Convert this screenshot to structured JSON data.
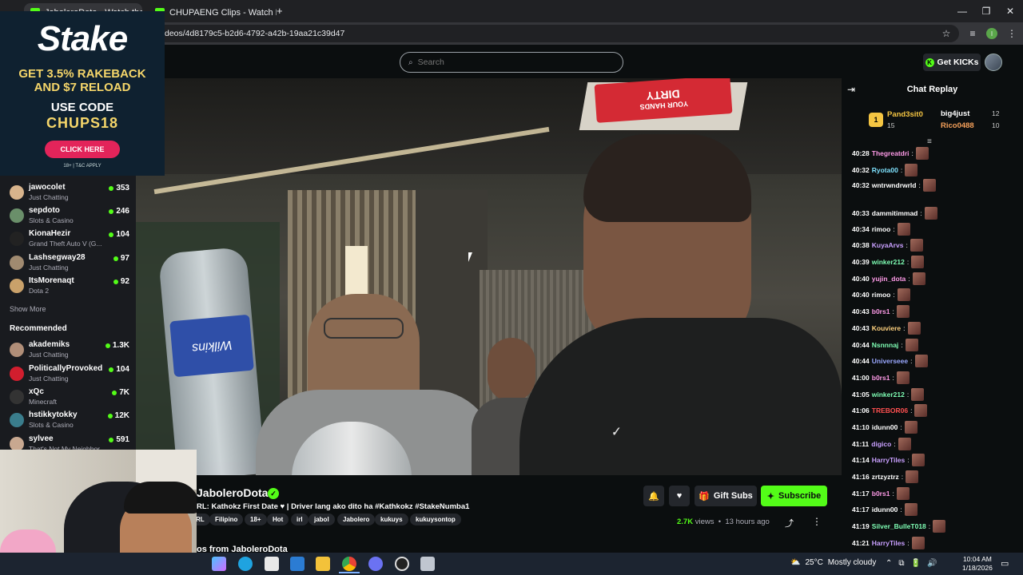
{
  "browser": {
    "tabs": [
      {
        "label": "JaboleroDota - Watch the L"
      },
      {
        "label": "CHUPAENG Clips - Watch Live"
      }
    ],
    "address": "deos/4d8179c5-b2d6-4792-a42b-19aa21c39d47",
    "new_tab": "+",
    "min": "—",
    "max": "❐",
    "close": "✕",
    "star": "☆",
    "profile_initial": "I"
  },
  "header": {
    "search_placeholder": "Search",
    "get_kicks": "Get KICKs"
  },
  "ad": {
    "logo": "Stake",
    "line1": "GET 3.5% RAKEBACK",
    "line1b": "AND $7 RELOAD",
    "line2": "USE CODE",
    "code": "CHUPS18",
    "button": "CLICK HERE",
    "fine": "18+ | T&C APPLY"
  },
  "sidebar": {
    "following": [
      {
        "name": "jawocolet",
        "category": "Just Chatting",
        "viewers": "353"
      },
      {
        "name": "sepdoto",
        "category": "Slots & Casino",
        "viewers": "246"
      },
      {
        "name": "KionaHezir",
        "category": "Grand Theft Auto V (G...",
        "viewers": "104"
      },
      {
        "name": "Lashsegway28",
        "category": "Just Chatting",
        "viewers": "97"
      },
      {
        "name": "ItsMorenaqt",
        "category": "Dota 2",
        "viewers": "92"
      }
    ],
    "show_more": "Show More",
    "recommended_title": "Recommended",
    "recommended": [
      {
        "name": "akademiks",
        "category": "Just Chatting",
        "viewers": "1.3K"
      },
      {
        "name": "PoliticallyProvoked",
        "category": "Just Chatting",
        "viewers": "104"
      },
      {
        "name": "xQc",
        "category": "Minecraft",
        "viewers": "7K"
      },
      {
        "name": "hstikkytokky",
        "category": "Slots & Casino",
        "viewers": "12K"
      },
      {
        "name": "sylvee",
        "category": "That's Not My Neighbor",
        "viewers": "591"
      }
    ]
  },
  "stream": {
    "channel": "JaboleroDota",
    "title": "RL: Kathokz First Date ♥ | Driver lang ako dito ha #Kathkokz #StakeNumba1",
    "tags": [
      "RL",
      "Filipino",
      "18+",
      "Hot",
      "irl",
      "jabol",
      "Jabolero",
      "kukuys",
      "kukuysontop"
    ],
    "views_count": "2.7K",
    "views_label": "views",
    "age": "13 hours ago",
    "gift_subs": "Gift Subs",
    "subscribe": "Subscribe",
    "videos_from": "os from JaboleroDota",
    "sign_text": "DIRTY",
    "sign_sub": "YOUR HANDS",
    "bottle_label": "Wilkins"
  },
  "chat": {
    "title": "Chat Replay",
    "leaders": [
      {
        "rank": "1",
        "name": "Pand3sit0",
        "count": "15"
      },
      {
        "name": "big4just",
        "count": "12"
      },
      {
        "name": "Rico0488",
        "count": "10"
      }
    ],
    "messages": [
      {
        "time": "40:28",
        "user": "Thegreatdri",
        "color": "#ff9be8",
        "text": ""
      },
      {
        "time": "40:32",
        "user": "Ryota00",
        "color": "#7fe3ff",
        "text": ""
      },
      {
        "time": "40:32",
        "user": "wntrwndrwrld",
        "color": "#ffffff",
        "text": ""
      },
      {
        "time": "40:33",
        "user": "dammitimmad",
        "color": "#ffffff",
        "text": ""
      },
      {
        "time": "40:34",
        "user": "rimoo",
        "color": "#ffffff",
        "text": ""
      },
      {
        "time": "40:38",
        "user": "KuyaArvs",
        "color": "#c9a0ff",
        "text": ""
      },
      {
        "time": "40:39",
        "user": "winker212",
        "color": "#7fffb5",
        "text": ""
      },
      {
        "time": "40:40",
        "user": "yujin_dota",
        "color": "#ff9be8",
        "text": ""
      },
      {
        "time": "40:40",
        "user": "rimoo",
        "color": "#ffffff",
        "text": ""
      },
      {
        "time": "40:43",
        "user": "b0rs1",
        "color": "#ff9be8",
        "text": ""
      },
      {
        "time": "40:43",
        "user": "Kouviere",
        "color": "#ffd27f",
        "text": ""
      },
      {
        "time": "40:44",
        "user": "Nsnnnaj",
        "color": "#7fffb5",
        "text": ""
      },
      {
        "time": "40:44",
        "user": "Universeee",
        "color": "#9aa8ff",
        "text": ""
      },
      {
        "time": "41:00",
        "user": "b0rs1",
        "color": "#ff9be8",
        "text": ""
      },
      {
        "time": "41:05",
        "user": "winker212",
        "color": "#7fffb5",
        "text": ""
      },
      {
        "time": "41:06",
        "user": "TREBOR06",
        "color": "#ff5050",
        "text": ""
      },
      {
        "time": "41:10",
        "user": "idunn00",
        "color": "#ffffff",
        "text": ""
      },
      {
        "time": "41:11",
        "user": "digico",
        "color": "#c9a0ff",
        "text": ""
      },
      {
        "time": "41:14",
        "user": "HarryTiles",
        "color": "#c9a0ff",
        "text": ""
      },
      {
        "time": "41:16",
        "user": "zrtzyztrz",
        "color": "#ffffff",
        "text": ""
      },
      {
        "time": "41:17",
        "user": "b0rs1",
        "color": "#ff9be8",
        "text": ""
      },
      {
        "time": "41:17",
        "user": "idunn00",
        "color": "#ffffff",
        "text": ""
      },
      {
        "time": "41:19",
        "user": "Silver_BulleT018",
        "color": "#7fffb5",
        "text": ""
      },
      {
        "time": "41:21",
        "user": "HarryTiles",
        "color": "#c9a0ff",
        "text": ""
      }
    ]
  },
  "taskbar": {
    "temp": "25°C",
    "weather": "Mostly cloudy",
    "time": "10:04 AM",
    "date": "1/18/2026"
  },
  "colors": {
    "kick_green": "#53fc18",
    "bg": "#0b0e0f",
    "stake_gold": "#f5d66a",
    "stake_pink": "#e3245a"
  }
}
